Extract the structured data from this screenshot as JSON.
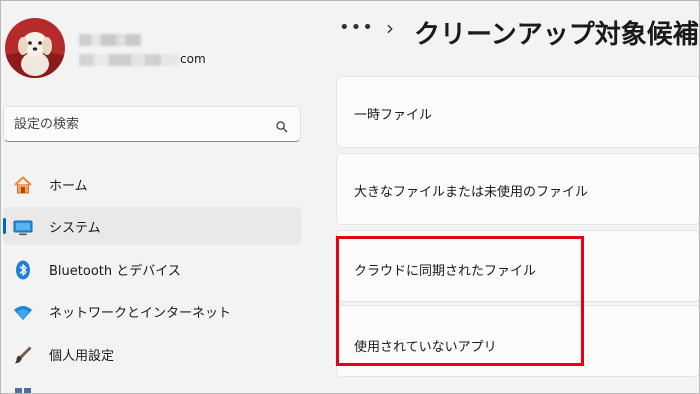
{
  "profile": {
    "email_suffix": "com"
  },
  "search": {
    "placeholder": "設定の検索"
  },
  "nav": {
    "items": [
      {
        "label": "ホーム",
        "icon": "home-icon"
      },
      {
        "label": "システム",
        "icon": "system-monitor-icon"
      },
      {
        "label": "Bluetooth とデバイス",
        "icon": "bluetooth-icon"
      },
      {
        "label": "ネットワークとインターネット",
        "icon": "wifi-icon"
      },
      {
        "label": "個人用設定",
        "icon": "paintbrush-icon"
      }
    ]
  },
  "header": {
    "more": "•••",
    "separator": "›",
    "title": "クリーンアップ対象候補"
  },
  "cards": [
    {
      "label": "一時ファイル"
    },
    {
      "label": "大きなファイルまたは未使用のファイル"
    },
    {
      "label": "クラウドに同期されたファイル"
    },
    {
      "label": "使用されていないアプリ"
    }
  ],
  "colors": {
    "accent": "#0067c0",
    "highlight": "#e60012"
  }
}
